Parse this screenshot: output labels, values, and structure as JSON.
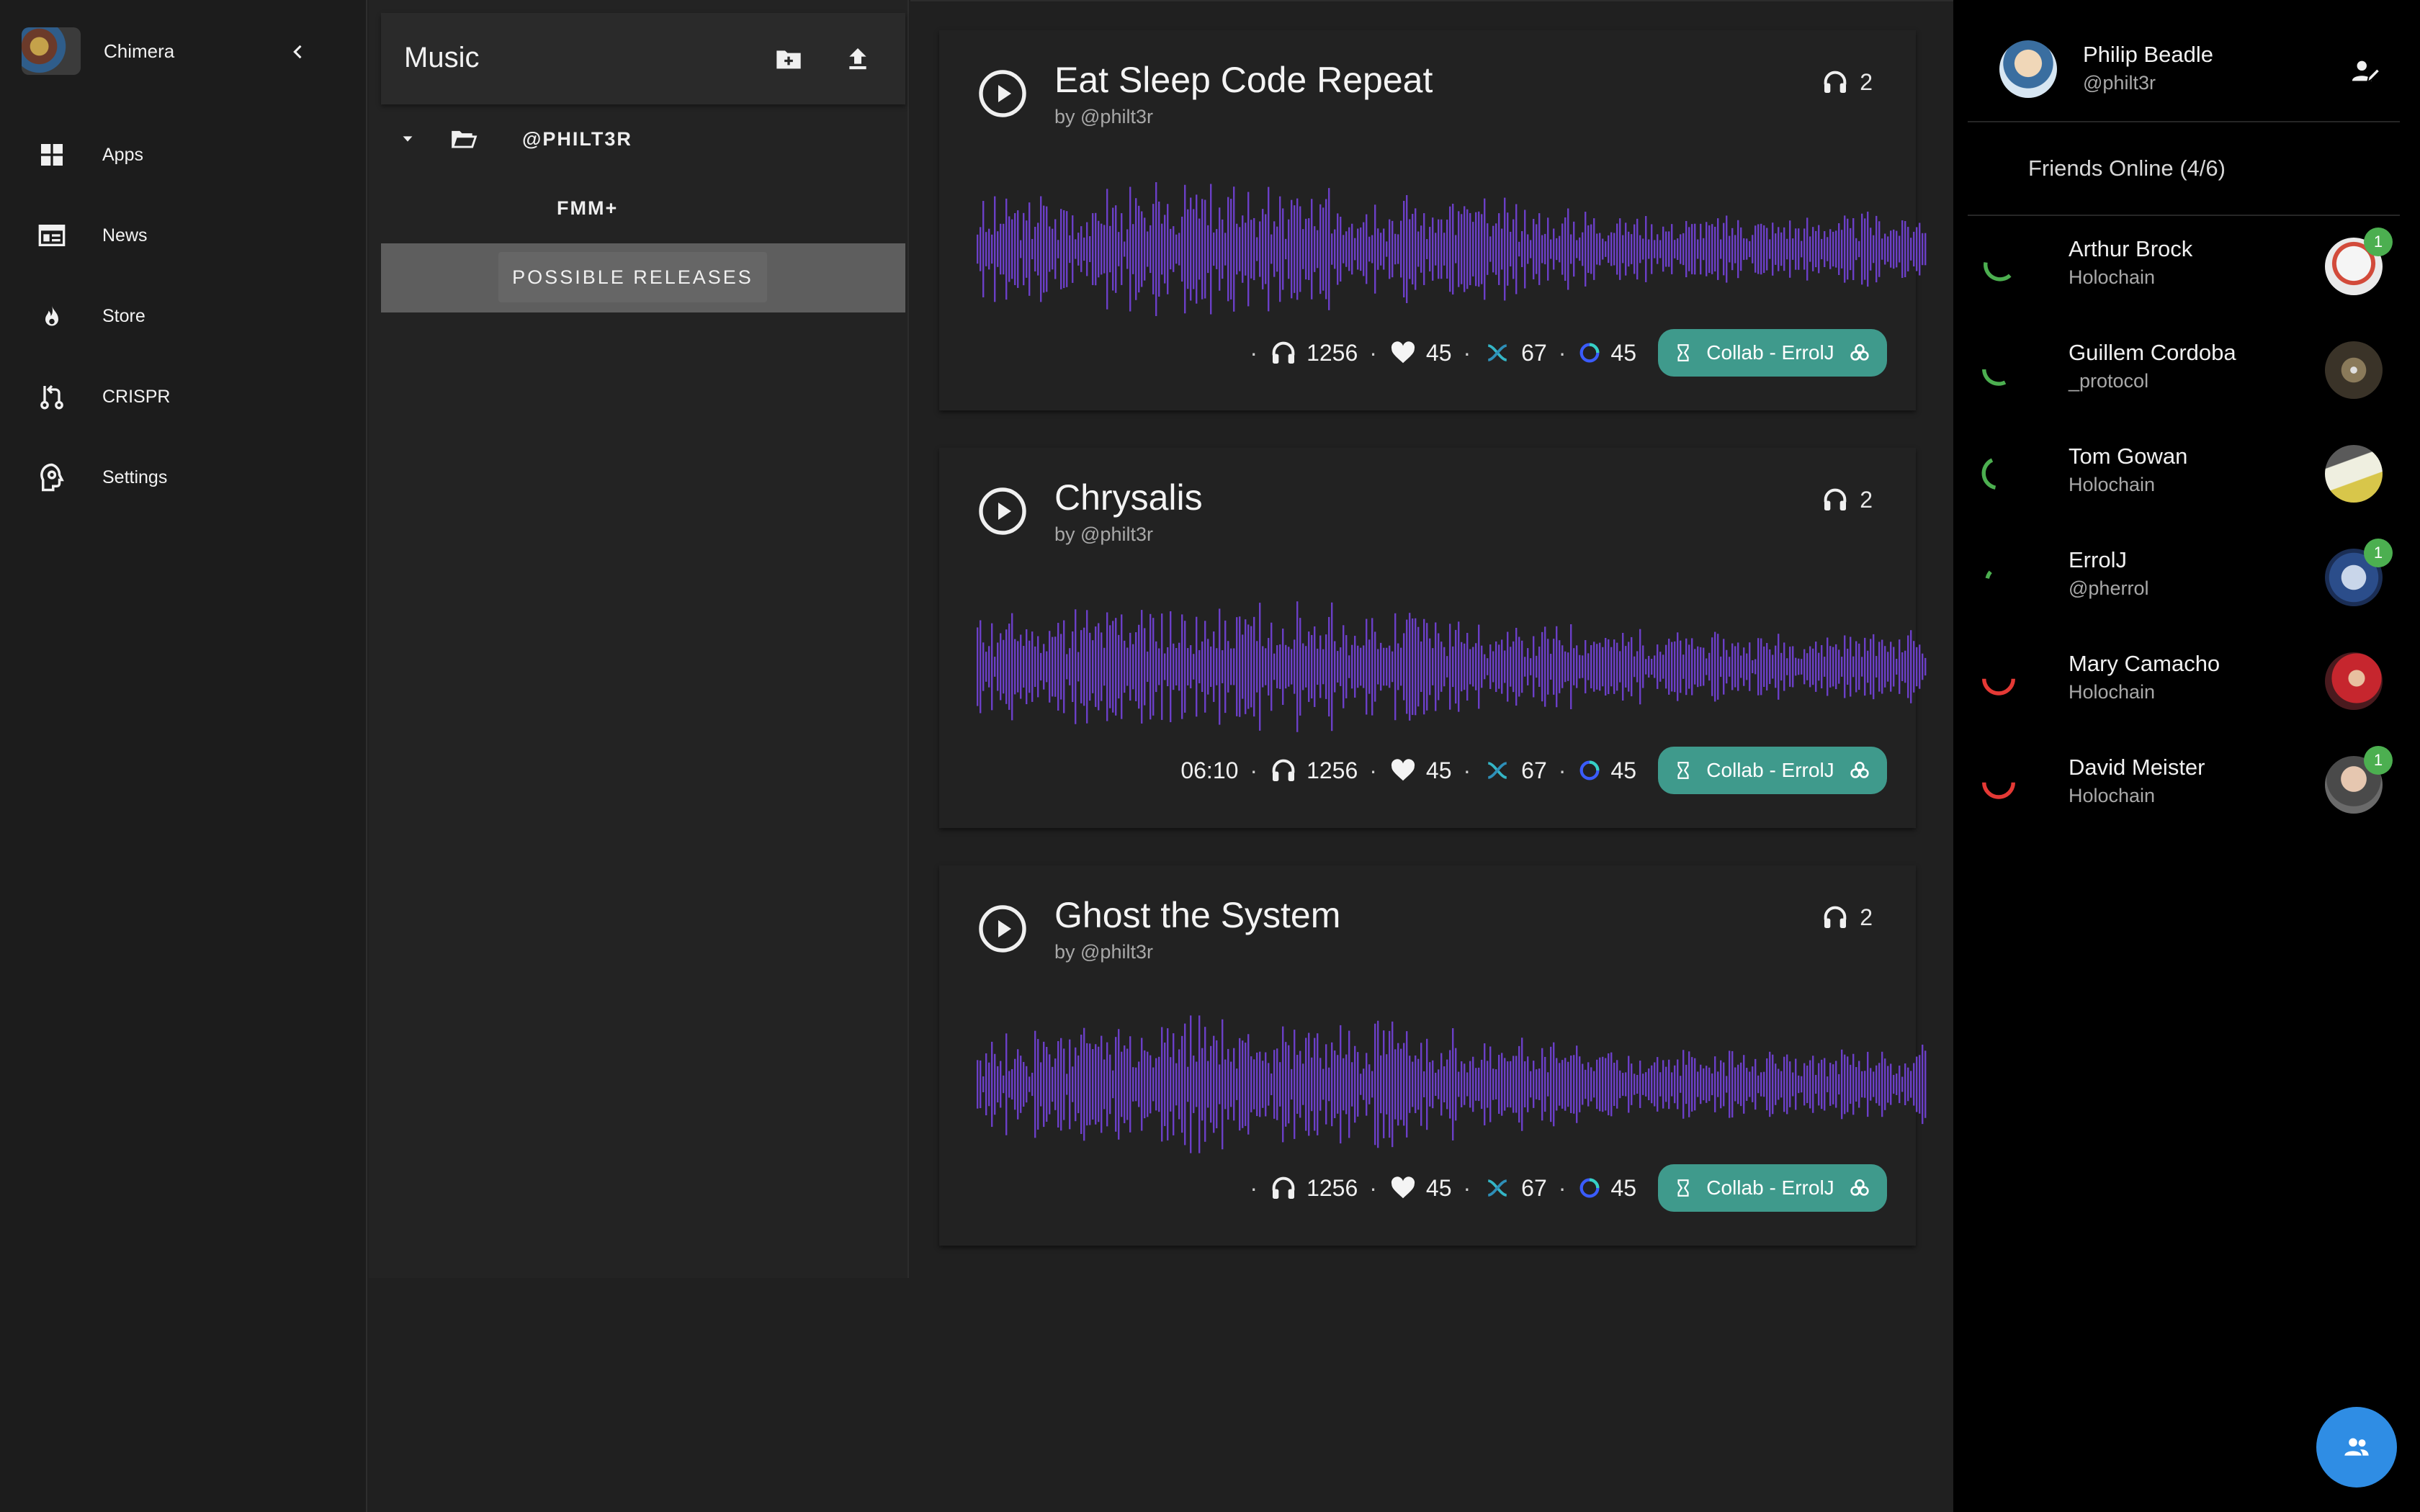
{
  "app": {
    "name": "Chimera"
  },
  "nav": {
    "items": [
      {
        "label": "Apps",
        "icon": "apps-grid-icon"
      },
      {
        "label": "News",
        "icon": "newspaper-icon"
      },
      {
        "label": "Store",
        "icon": "flame-icon"
      },
      {
        "label": "CRISPR",
        "icon": "merge-icon"
      },
      {
        "label": "Settings",
        "icon": "head-gear-icon"
      }
    ]
  },
  "folders": {
    "title": "Music",
    "tree": [
      {
        "label": "@PHILT3R"
      },
      {
        "label": "FMM+"
      },
      {
        "label": "POSSIBLE RELEASES",
        "selected": true
      }
    ]
  },
  "tracks": [
    {
      "title": "Eat Sleep Code Repeat",
      "by": "by @philt3r",
      "listeners": "2",
      "duration": "",
      "plays": "1256",
      "likes": "45",
      "remixes": "67",
      "holo": "45",
      "collab": "Collab - ErrolJ"
    },
    {
      "title": "Chrysalis",
      "by": "by @philt3r",
      "listeners": "2",
      "duration": "06:10",
      "plays": "1256",
      "likes": "45",
      "remixes": "67",
      "holo": "45",
      "collab": "Collab - ErrolJ"
    },
    {
      "title": "Ghost the System",
      "by": "by @philt3r",
      "listeners": "2",
      "duration": "",
      "plays": "1256",
      "likes": "45",
      "remixes": "67",
      "holo": "45",
      "collab": "Collab - ErrolJ"
    }
  ],
  "profile": {
    "name": "Philip Beadle",
    "handle": "@philt3r"
  },
  "friends_online": "Friends Online (4/6)",
  "friends": [
    {
      "name": "Arthur Brock",
      "sub": "Holochain",
      "status_color": "#4caf50",
      "badge": "1"
    },
    {
      "name": "Guillem Cordoba",
      "sub": "_protocol",
      "status_color": "#4caf50",
      "badge": ""
    },
    {
      "name": "Tom Gowan",
      "sub": "Holochain",
      "status_color": "#4caf50",
      "badge": ""
    },
    {
      "name": "ErrolJ",
      "sub": "@pherrol",
      "status_color": "#4caf50",
      "badge": "1"
    },
    {
      "name": "Mary Camacho",
      "sub": "Holochain",
      "status_color": "#e53935",
      "badge": ""
    },
    {
      "name": "David Meister",
      "sub": "Holochain",
      "status_color": "#e53935",
      "badge": "1"
    }
  ],
  "colors": {
    "waveform": "#6b3fc7",
    "collab": "#3f9a8c",
    "fab": "#2f8de4"
  }
}
